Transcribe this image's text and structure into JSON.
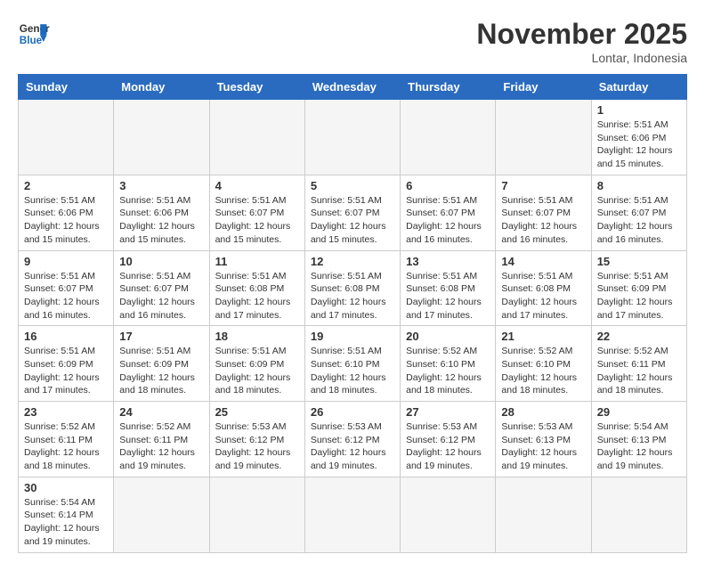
{
  "header": {
    "logo_general": "General",
    "logo_blue": "Blue",
    "month_title": "November 2025",
    "subtitle": "Lontar, Indonesia"
  },
  "days_of_week": [
    "Sunday",
    "Monday",
    "Tuesday",
    "Wednesday",
    "Thursday",
    "Friday",
    "Saturday"
  ],
  "weeks": [
    [
      {
        "day": "",
        "info": ""
      },
      {
        "day": "",
        "info": ""
      },
      {
        "day": "",
        "info": ""
      },
      {
        "day": "",
        "info": ""
      },
      {
        "day": "",
        "info": ""
      },
      {
        "day": "",
        "info": ""
      },
      {
        "day": "1",
        "info": "Sunrise: 5:51 AM\nSunset: 6:06 PM\nDaylight: 12 hours and 15 minutes."
      }
    ],
    [
      {
        "day": "2",
        "info": "Sunrise: 5:51 AM\nSunset: 6:06 PM\nDaylight: 12 hours and 15 minutes."
      },
      {
        "day": "3",
        "info": "Sunrise: 5:51 AM\nSunset: 6:06 PM\nDaylight: 12 hours and 15 minutes."
      },
      {
        "day": "4",
        "info": "Sunrise: 5:51 AM\nSunset: 6:07 PM\nDaylight: 12 hours and 15 minutes."
      },
      {
        "day": "5",
        "info": "Sunrise: 5:51 AM\nSunset: 6:07 PM\nDaylight: 12 hours and 15 minutes."
      },
      {
        "day": "6",
        "info": "Sunrise: 5:51 AM\nSunset: 6:07 PM\nDaylight: 12 hours and 16 minutes."
      },
      {
        "day": "7",
        "info": "Sunrise: 5:51 AM\nSunset: 6:07 PM\nDaylight: 12 hours and 16 minutes."
      },
      {
        "day": "8",
        "info": "Sunrise: 5:51 AM\nSunset: 6:07 PM\nDaylight: 12 hours and 16 minutes."
      }
    ],
    [
      {
        "day": "9",
        "info": "Sunrise: 5:51 AM\nSunset: 6:07 PM\nDaylight: 12 hours and 16 minutes."
      },
      {
        "day": "10",
        "info": "Sunrise: 5:51 AM\nSunset: 6:07 PM\nDaylight: 12 hours and 16 minutes."
      },
      {
        "day": "11",
        "info": "Sunrise: 5:51 AM\nSunset: 6:08 PM\nDaylight: 12 hours and 17 minutes."
      },
      {
        "day": "12",
        "info": "Sunrise: 5:51 AM\nSunset: 6:08 PM\nDaylight: 12 hours and 17 minutes."
      },
      {
        "day": "13",
        "info": "Sunrise: 5:51 AM\nSunset: 6:08 PM\nDaylight: 12 hours and 17 minutes."
      },
      {
        "day": "14",
        "info": "Sunrise: 5:51 AM\nSunset: 6:08 PM\nDaylight: 12 hours and 17 minutes."
      },
      {
        "day": "15",
        "info": "Sunrise: 5:51 AM\nSunset: 6:09 PM\nDaylight: 12 hours and 17 minutes."
      }
    ],
    [
      {
        "day": "16",
        "info": "Sunrise: 5:51 AM\nSunset: 6:09 PM\nDaylight: 12 hours and 17 minutes."
      },
      {
        "day": "17",
        "info": "Sunrise: 5:51 AM\nSunset: 6:09 PM\nDaylight: 12 hours and 18 minutes."
      },
      {
        "day": "18",
        "info": "Sunrise: 5:51 AM\nSunset: 6:09 PM\nDaylight: 12 hours and 18 minutes."
      },
      {
        "day": "19",
        "info": "Sunrise: 5:51 AM\nSunset: 6:10 PM\nDaylight: 12 hours and 18 minutes."
      },
      {
        "day": "20",
        "info": "Sunrise: 5:52 AM\nSunset: 6:10 PM\nDaylight: 12 hours and 18 minutes."
      },
      {
        "day": "21",
        "info": "Sunrise: 5:52 AM\nSunset: 6:10 PM\nDaylight: 12 hours and 18 minutes."
      },
      {
        "day": "22",
        "info": "Sunrise: 5:52 AM\nSunset: 6:11 PM\nDaylight: 12 hours and 18 minutes."
      }
    ],
    [
      {
        "day": "23",
        "info": "Sunrise: 5:52 AM\nSunset: 6:11 PM\nDaylight: 12 hours and 18 minutes."
      },
      {
        "day": "24",
        "info": "Sunrise: 5:52 AM\nSunset: 6:11 PM\nDaylight: 12 hours and 19 minutes."
      },
      {
        "day": "25",
        "info": "Sunrise: 5:53 AM\nSunset: 6:12 PM\nDaylight: 12 hours and 19 minutes."
      },
      {
        "day": "26",
        "info": "Sunrise: 5:53 AM\nSunset: 6:12 PM\nDaylight: 12 hours and 19 minutes."
      },
      {
        "day": "27",
        "info": "Sunrise: 5:53 AM\nSunset: 6:12 PM\nDaylight: 12 hours and 19 minutes."
      },
      {
        "day": "28",
        "info": "Sunrise: 5:53 AM\nSunset: 6:13 PM\nDaylight: 12 hours and 19 minutes."
      },
      {
        "day": "29",
        "info": "Sunrise: 5:54 AM\nSunset: 6:13 PM\nDaylight: 12 hours and 19 minutes."
      }
    ],
    [
      {
        "day": "30",
        "info": "Sunrise: 5:54 AM\nSunset: 6:14 PM\nDaylight: 12 hours and 19 minutes."
      },
      {
        "day": "",
        "info": ""
      },
      {
        "day": "",
        "info": ""
      },
      {
        "day": "",
        "info": ""
      },
      {
        "day": "",
        "info": ""
      },
      {
        "day": "",
        "info": ""
      },
      {
        "day": "",
        "info": ""
      }
    ]
  ]
}
